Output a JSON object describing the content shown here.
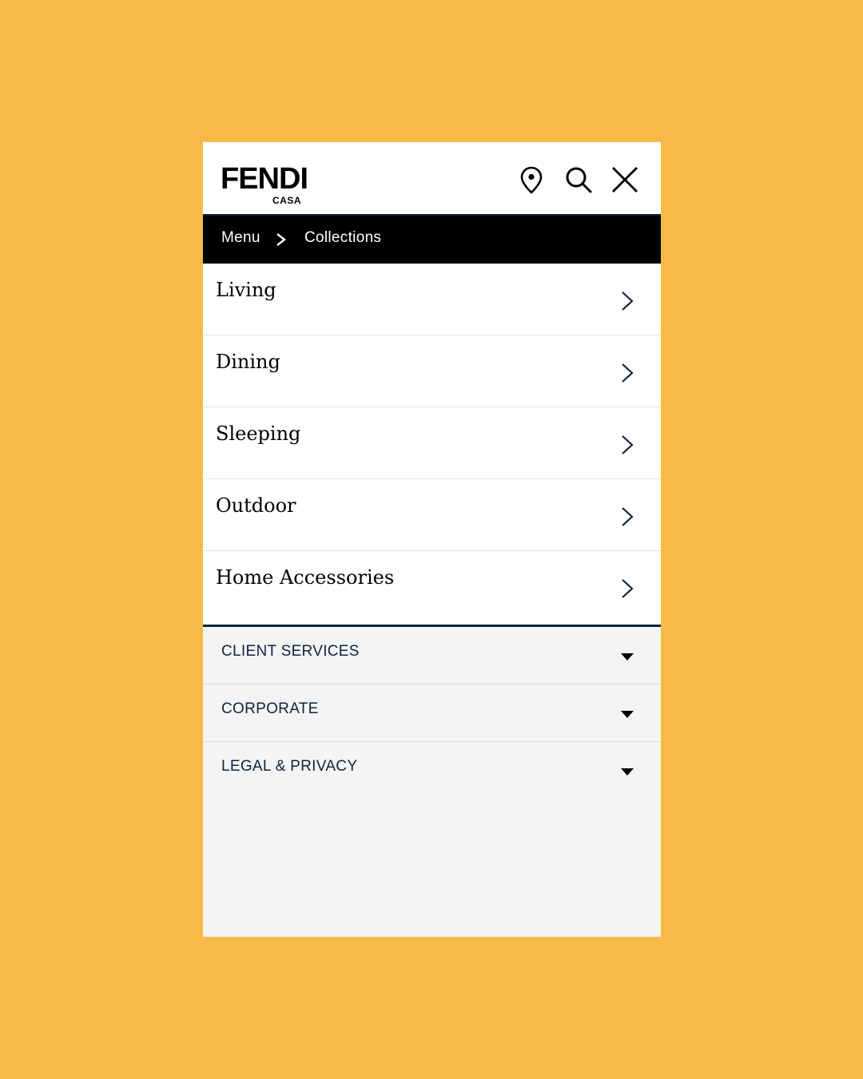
{
  "colors": {
    "background": "#F7B948",
    "navy": "#0F2340",
    "breadcrumb_bg": "#000000",
    "footer_bg": "#F4F4F4"
  },
  "header": {
    "logo_main": "FENDI",
    "logo_sub": "CASA",
    "icons": [
      "location-pin-icon",
      "search-icon",
      "close-icon"
    ]
  },
  "breadcrumb": {
    "root": "Menu",
    "separator_icon": "chevron-right-icon",
    "current": "Collections"
  },
  "categories": [
    {
      "label": "Living",
      "icon": "chevron-right-icon"
    },
    {
      "label": "Dining",
      "icon": "chevron-right-icon"
    },
    {
      "label": "Sleeping",
      "icon": "chevron-right-icon"
    },
    {
      "label": "Outdoor",
      "icon": "chevron-right-icon"
    },
    {
      "label": "Home Accessories",
      "icon": "chevron-right-icon"
    }
  ],
  "footer": [
    {
      "label": "CLIENT SERVICES",
      "icon": "caret-down-icon"
    },
    {
      "label": "CORPORATE",
      "icon": "caret-down-icon"
    },
    {
      "label": "LEGAL & PRIVACY",
      "icon": "caret-down-icon"
    }
  ]
}
